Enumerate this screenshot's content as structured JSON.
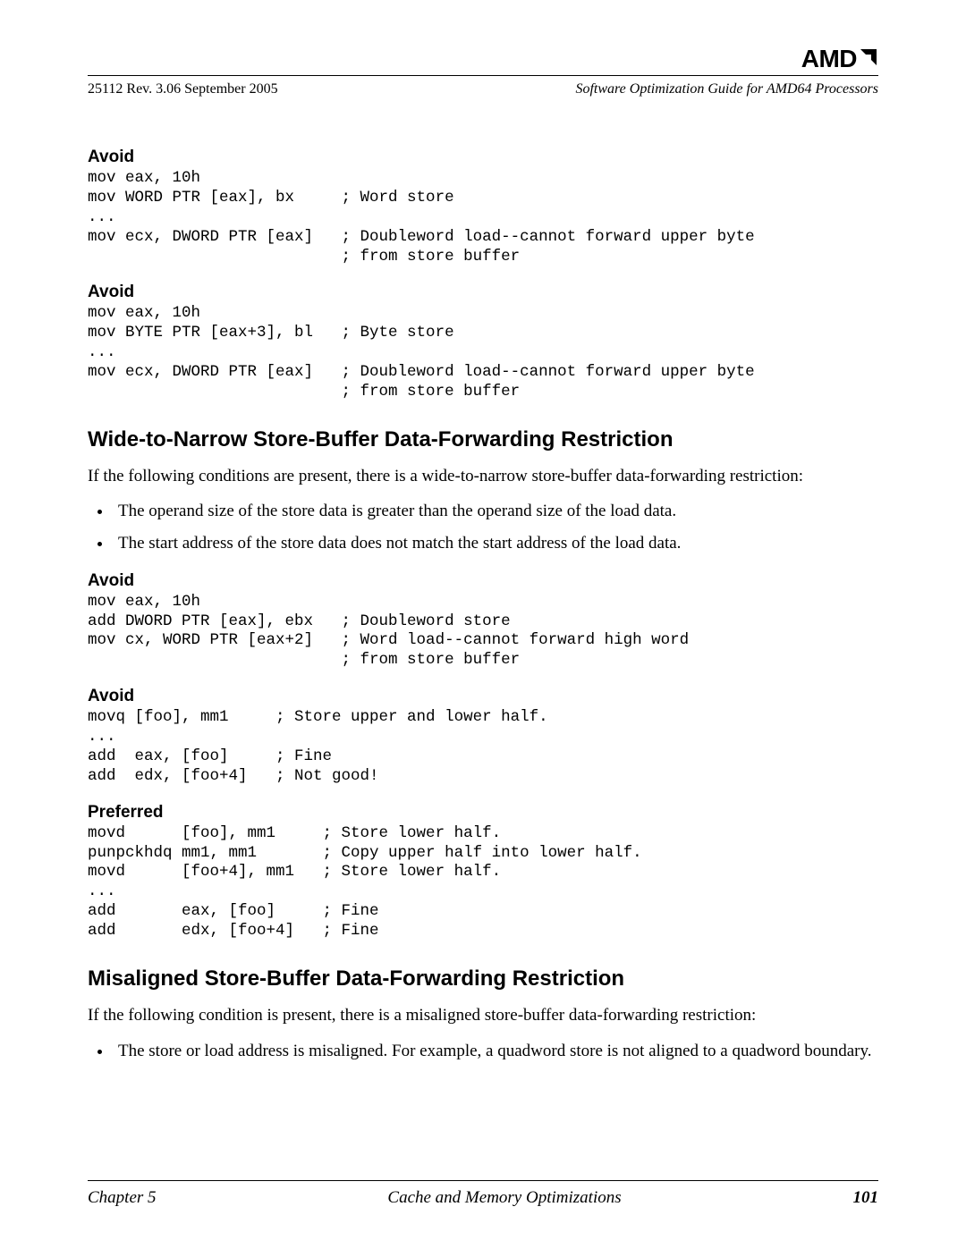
{
  "brand": "AMD",
  "header": {
    "left": "25112   Rev. 3.06   September 2005",
    "right": "Software Optimization Guide for AMD64 Processors"
  },
  "sections": {
    "avoid1": {
      "label": "Avoid",
      "code": "mov eax, 10h\nmov WORD PTR [eax], bx     ; Word store\n...\nmov ecx, DWORD PTR [eax]   ; Doubleword load--cannot forward upper byte\n                           ; from store buffer"
    },
    "avoid2": {
      "label": "Avoid",
      "code": "mov eax, 10h\nmov BYTE PTR [eax+3], bl   ; Byte store\n...\nmov ecx, DWORD PTR [eax]   ; Doubleword load--cannot forward upper byte\n                           ; from store buffer"
    },
    "wide_heading": "Wide-to-Narrow Store-Buffer Data-Forwarding Restriction",
    "wide_intro": "If the following conditions are present, there is a wide-to-narrow store-buffer data-forwarding restriction:",
    "wide_bullets": [
      "The operand size of the store data is greater than the operand size of the load data.",
      "The start address of the store data does not match the start address of the load data."
    ],
    "avoid3": {
      "label": "Avoid",
      "code": "mov eax, 10h\nadd DWORD PTR [eax], ebx   ; Doubleword store\nmov cx, WORD PTR [eax+2]   ; Word load--cannot forward high word\n                           ; from store buffer"
    },
    "avoid4": {
      "label": "Avoid",
      "code": "movq [foo], mm1     ; Store upper and lower half.\n...\nadd  eax, [foo]     ; Fine\nadd  edx, [foo+4]   ; Not good!"
    },
    "preferred": {
      "label": "Preferred",
      "code": "movd      [foo], mm1     ; Store lower half.\npunpckhdq mm1, mm1       ; Copy upper half into lower half.\nmovd      [foo+4], mm1   ; Store lower half.\n...\nadd       eax, [foo]     ; Fine\nadd       edx, [foo+4]   ; Fine"
    },
    "mis_heading": "Misaligned Store-Buffer Data-Forwarding Restriction",
    "mis_intro": "If the following condition is present, there is a misaligned store-buffer data-forwarding restriction:",
    "mis_bullets": [
      "The store or load address is misaligned. For example, a quadword store is not aligned to a quadword boundary."
    ]
  },
  "footer": {
    "left": "Chapter 5",
    "center": "Cache and Memory Optimizations",
    "right": "101"
  }
}
